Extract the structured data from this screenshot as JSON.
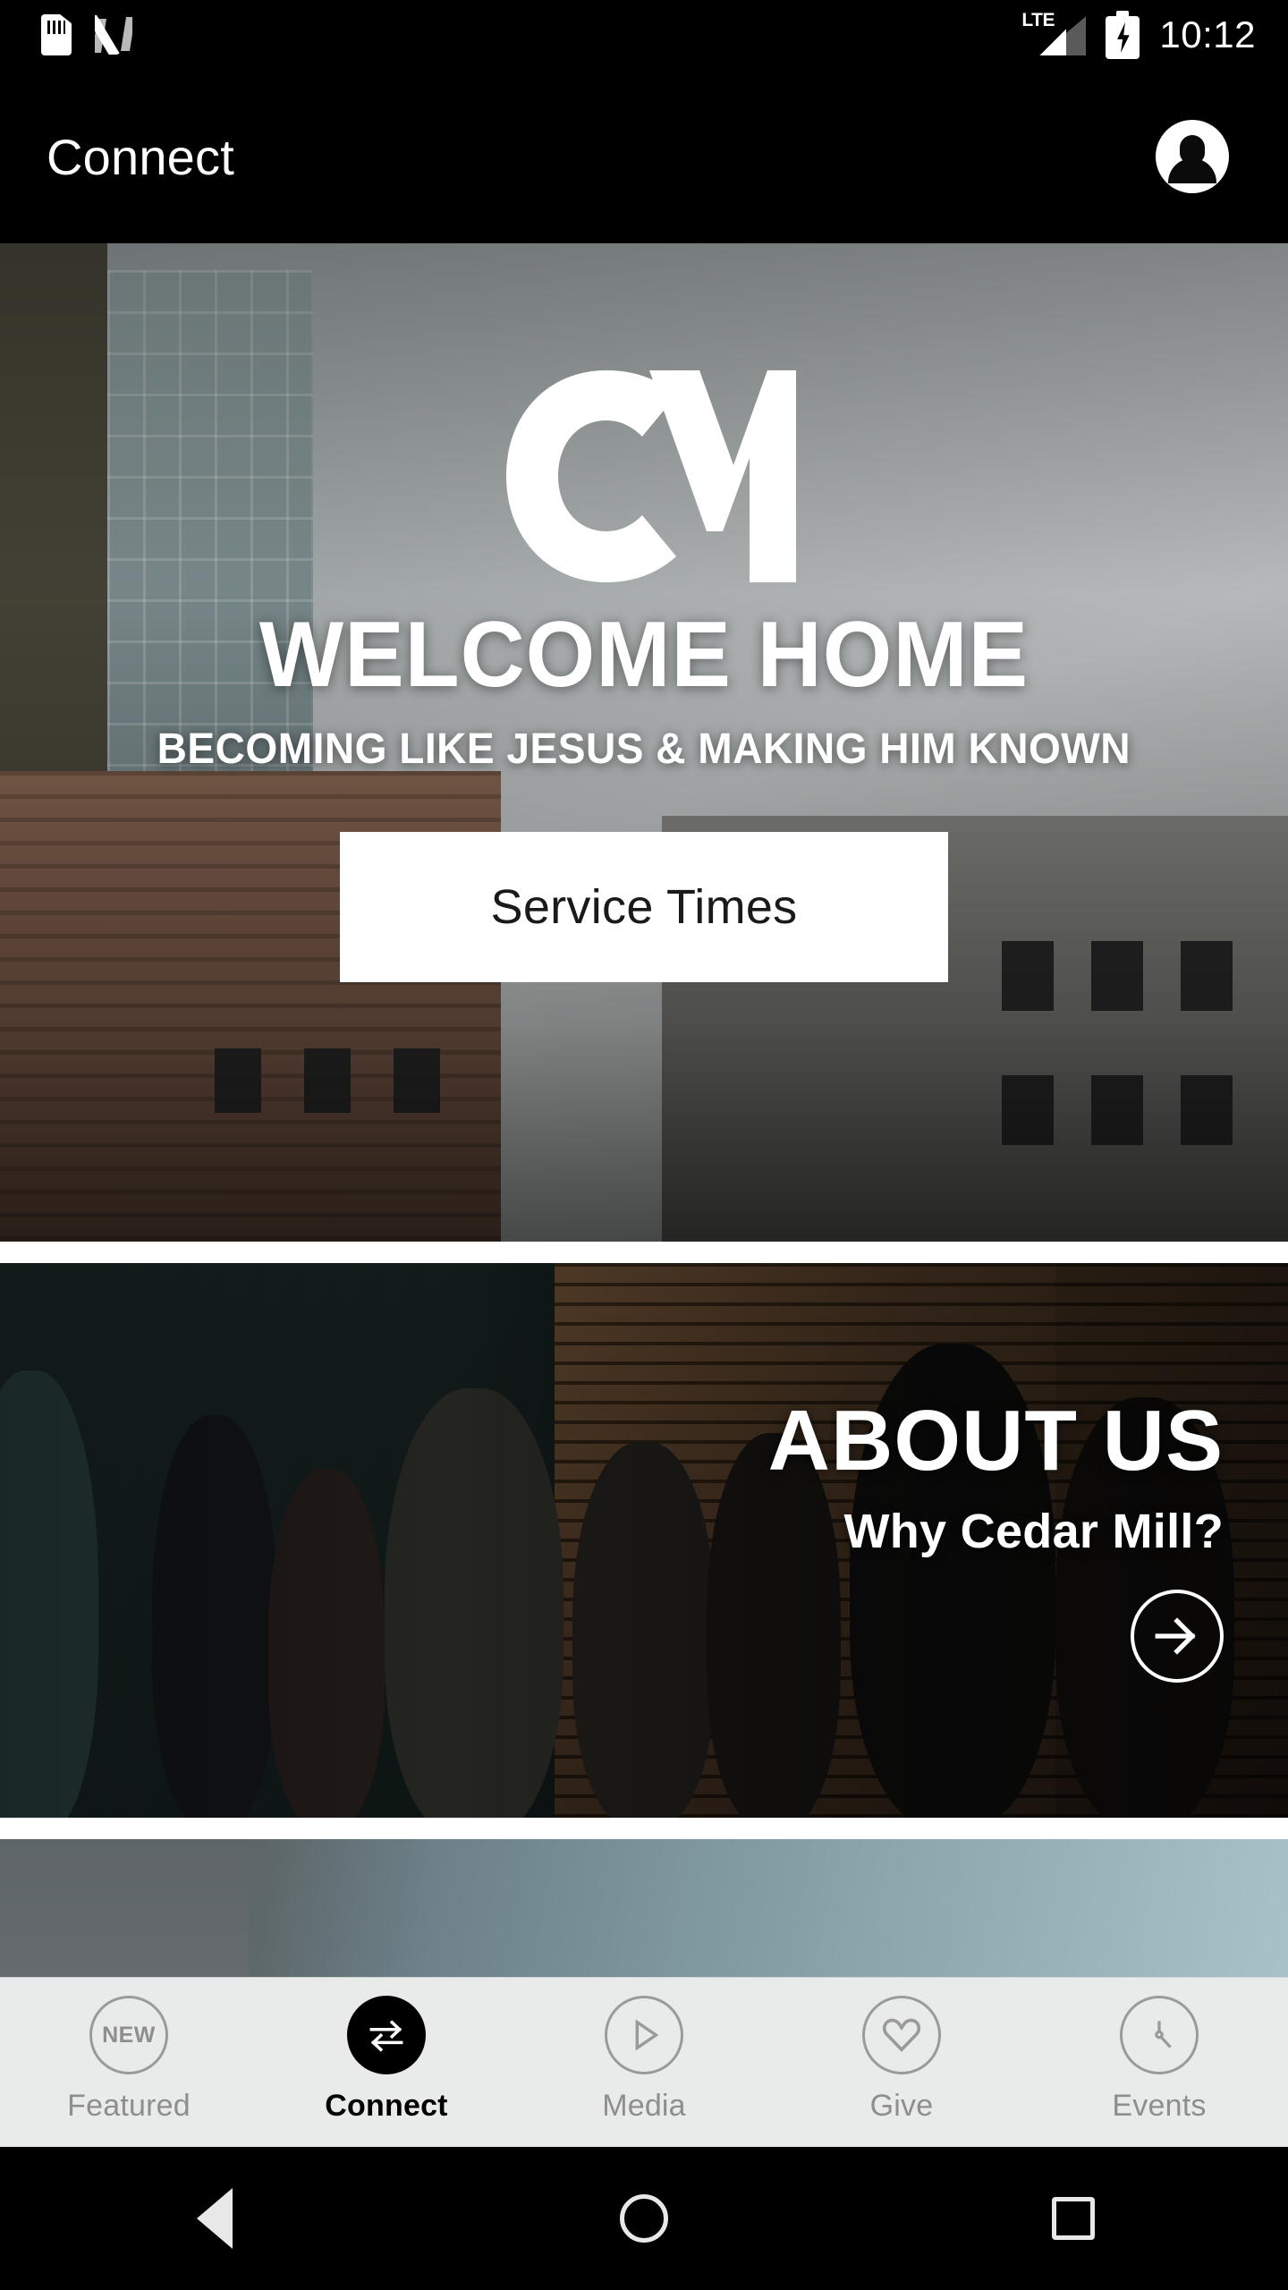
{
  "status_bar": {
    "icons_left": [
      "sd-card-icon",
      "nfc-icon"
    ],
    "network_label": "LTE",
    "battery_state": "charging",
    "time": "10:12"
  },
  "app_bar": {
    "title": "Connect",
    "account_icon": "account-circle-icon"
  },
  "hero": {
    "logo_text": "CM",
    "title": "WELCOME HOME",
    "subtitle": "BECOMING LIKE JESUS & MAKING HIM KNOWN",
    "button_label": "Service Times"
  },
  "about": {
    "title": "ABOUT US",
    "subtitle": "Why Cedar Mill?",
    "arrow_icon": "arrow-right-circle-icon"
  },
  "tabs": [
    {
      "label": "Featured",
      "icon": "new-badge-icon",
      "icon_text": "NEW",
      "active": false
    },
    {
      "label": "Connect",
      "icon": "swap-arrows-icon",
      "icon_text": "",
      "active": true
    },
    {
      "label": "Media",
      "icon": "play-circle-icon",
      "icon_text": "",
      "active": false
    },
    {
      "label": "Give",
      "icon": "heart-icon",
      "icon_text": "",
      "active": false
    },
    {
      "label": "Events",
      "icon": "clock-icon",
      "icon_text": "",
      "active": false
    }
  ],
  "android_nav": {
    "back": "back-triangle-icon",
    "home": "home-circle-icon",
    "recents": "recents-square-icon"
  },
  "colors": {
    "app_bar_bg": "#000000",
    "tab_bar_bg": "#e9eaea",
    "tab_active": "#000000",
    "tab_inactive": "#8e8e8e",
    "button_bg": "#ffffff",
    "button_text": "#1a1a1a"
  }
}
